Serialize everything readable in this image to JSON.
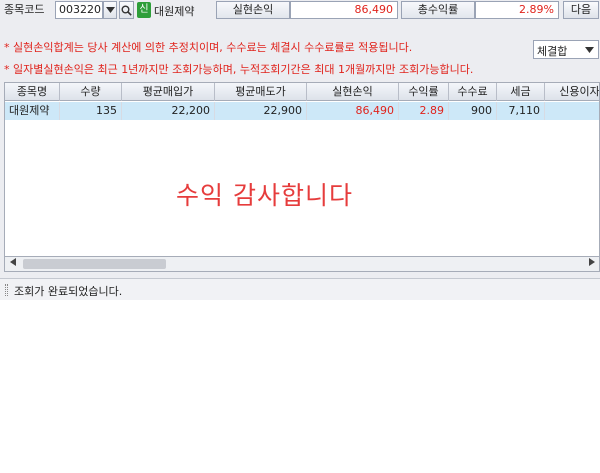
{
  "toolbar": {
    "code_label": "종목코드",
    "code_value": "003220",
    "credit_badge": "신",
    "stock_name": "대원제약",
    "realized_label": "실현손익",
    "realized_value": "86,490",
    "total_return_label": "총수익률",
    "total_return_value": "2.89%",
    "next_button": "다음",
    "basis_select": "체결합"
  },
  "notices": [
    "* 실현손익합계는 당사 계산에 의한 추정치이며, 수수료는 체결시 수수료률로 적용됩니다.",
    "* 일자별실현손익은 최근 1년까지만 조회가능하며, 누적조회기간은 최대 1개월까지만 조회가능합니다."
  ],
  "table": {
    "headers": [
      "종목명",
      "수량",
      "평균매입가",
      "평균매도가",
      "실현손익",
      "수익률",
      "수수료",
      "세금",
      "신용이자"
    ],
    "rows": [
      [
        "대원제약",
        "135",
        "22,200",
        "22,900",
        "86,490",
        "2.89",
        "900",
        "7,110",
        ""
      ]
    ]
  },
  "overlay_text": "수익 감사합니다",
  "status": "조회가 완료되었습니다.",
  "colors": {
    "accent_red": "#e0231c",
    "row_highlight": "#cde8f8",
    "badge_green": "#2e9e3a"
  },
  "icons": {
    "dropdown": "chevron-down-icon",
    "search": "search-icon",
    "scroll_left": "chevron-left-icon",
    "scroll_right": "chevron-right-icon"
  }
}
